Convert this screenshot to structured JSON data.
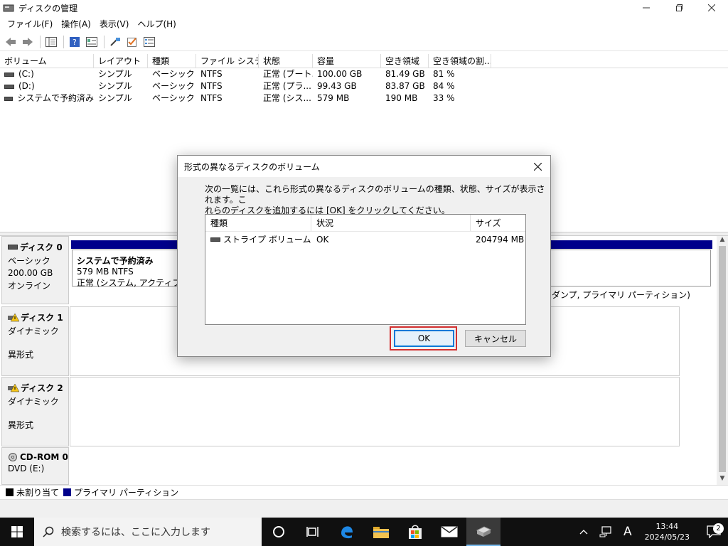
{
  "window": {
    "title": "ディスクの管理"
  },
  "menu": [
    "ファイル(F)",
    "操作(A)",
    "表示(V)",
    "ヘルプ(H)"
  ],
  "volume_table": {
    "columns": [
      "ボリューム",
      "レイアウト",
      "種類",
      "ファイル システム",
      "状態",
      "容量",
      "空き領域",
      "空き領域の割..."
    ],
    "rows": [
      [
        "(C:)",
        "シンプル",
        "ベーシック",
        "NTFS",
        "正常 (ブート...",
        "100.00 GB",
        "81.49 GB",
        "81 %"
      ],
      [
        "(D:)",
        "シンプル",
        "ベーシック",
        "NTFS",
        "正常 (プラ...",
        "99.43 GB",
        "83.87 GB",
        "84 %"
      ],
      [
        "システムで予約済み",
        "シンプル",
        "ベーシック",
        "NTFS",
        "正常 (シス...",
        "579 MB",
        "190 MB",
        "33 %"
      ]
    ]
  },
  "disks": {
    "disk0": {
      "name": "ディスク 0",
      "type": "ベーシック",
      "size": "200.00 GB",
      "status": "オンライン",
      "partition_name": "システムで予約済み",
      "partition_size": "579 MB NTFS",
      "partition_status": "正常 (システム, アクティブ, プラ",
      "partition_tail": "ル, クラッシュ ダンプ, プライマリ パーティション)"
    },
    "disk1": {
      "name": "ディスク 1",
      "type": "ダイナミック",
      "status": "異形式"
    },
    "disk2": {
      "name": "ディスク 2",
      "type": "ダイナミック",
      "status": "異形式"
    },
    "cdrom0": {
      "name": "CD-ROM 0",
      "type": "DVD (E:)"
    }
  },
  "legend": [
    {
      "label": "未割り当て",
      "color": "#000000"
    },
    {
      "label": "プライマリ パーティション",
      "color": "#00008b"
    }
  ],
  "dialog": {
    "title": "形式の異なるディスクのボリューム",
    "message_line1": "次の一覧には、これら形式の異なるディスクのボリュームの種類、状態、サイズが表示されます。こ",
    "message_line2": "れらのディスクを追加するには [OK] をクリックしてください。",
    "columns": [
      "種類",
      "状況",
      "サイズ"
    ],
    "rows": [
      [
        "ストライプ ボリューム",
        "OK",
        "204794 MB"
      ]
    ],
    "ok_label": "OK",
    "cancel_label": "キャンセル"
  },
  "taskbar": {
    "search_placeholder": "検索するには、ここに入力します",
    "time": "13:44",
    "date": "2024/05/23",
    "ime": "A",
    "notification_count": "2"
  },
  "colors": {
    "primary_partition": "#00008b",
    "highlight": "#d32f2f",
    "focus": "#0078d7"
  }
}
